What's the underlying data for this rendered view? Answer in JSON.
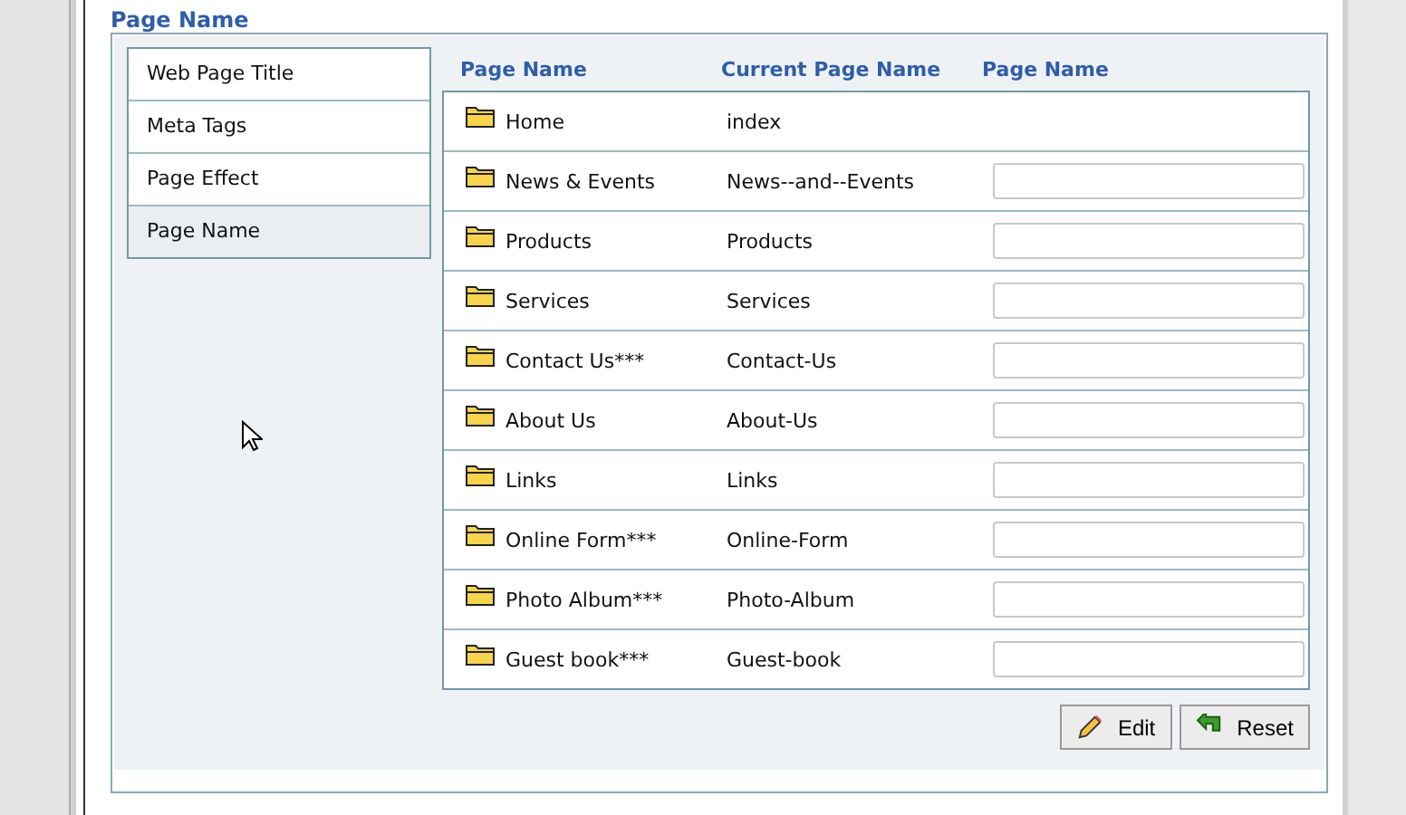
{
  "title": "Page Name",
  "sidebar": {
    "items": [
      {
        "label": "Web Page Title",
        "selected": false
      },
      {
        "label": "Meta Tags",
        "selected": false
      },
      {
        "label": "Page Effect",
        "selected": false
      },
      {
        "label": "Page Name",
        "selected": true
      }
    ]
  },
  "table": {
    "columns": [
      "Page Name",
      "Current Page Name",
      "Page Name"
    ],
    "rows": [
      {
        "name": "Home",
        "current": "index",
        "editable": false
      },
      {
        "name": "News & Events",
        "current": "News--and--Events",
        "editable": true
      },
      {
        "name": "Products",
        "current": "Products",
        "editable": true
      },
      {
        "name": "Services",
        "current": "Services",
        "editable": true
      },
      {
        "name": "Contact Us***",
        "current": "Contact-Us",
        "editable": true
      },
      {
        "name": "About Us",
        "current": "About-Us",
        "editable": true
      },
      {
        "name": "Links",
        "current": "Links",
        "editable": true
      },
      {
        "name": "Online Form***",
        "current": "Online-Form",
        "editable": true
      },
      {
        "name": "Photo Album***",
        "current": "Photo-Album",
        "editable": true
      },
      {
        "name": "Guest book***",
        "current": "Guest-book",
        "editable": true
      }
    ]
  },
  "buttons": [
    {
      "label": "Edit",
      "kind": "edit"
    },
    {
      "label": "Reset",
      "kind": "reset"
    }
  ]
}
